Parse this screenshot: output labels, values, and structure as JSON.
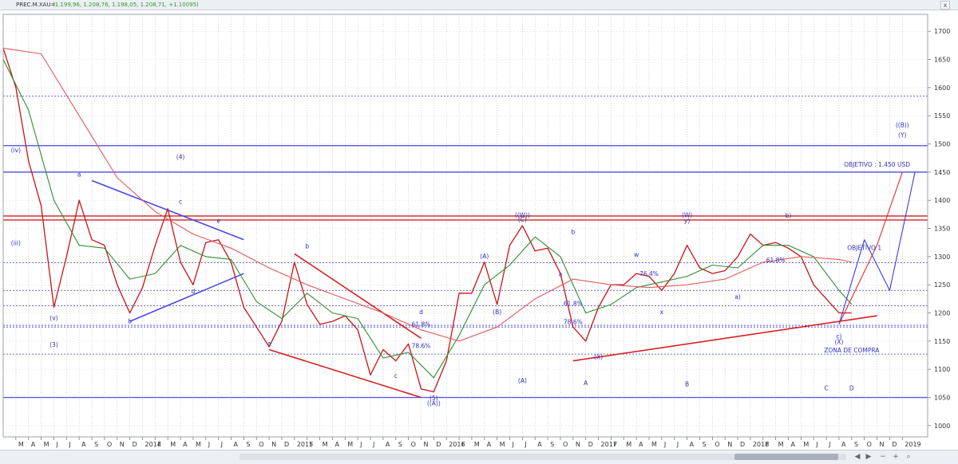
{
  "window": {
    "title": "PREC.M.XAU=",
    "quote_text": "(1.199,96, 1.208,76, 1.198,05, 1.208,71, +1.10095)",
    "close_glyph": "x"
  },
  "chart_data": {
    "type": "line",
    "title": "",
    "xlabel": "",
    "ylabel": "",
    "ylim": [
      980,
      1730
    ],
    "y_ticks": [
      1000,
      1050,
      1100,
      1150,
      1200,
      1250,
      1300,
      1350,
      1400,
      1450,
      1500,
      1550,
      1600,
      1650,
      1700
    ],
    "grid": true,
    "x_axis": {
      "start": "2013-02",
      "end": "2019-03",
      "labels": [
        "M",
        "A",
        "M",
        "J",
        "J",
        "A",
        "S",
        "O",
        "N",
        "D",
        "2014",
        "F",
        "M",
        "A",
        "M",
        "J",
        "J",
        "A",
        "S",
        "O",
        "N",
        "D",
        "2015",
        "F",
        "M",
        "A",
        "M",
        "J",
        "J",
        "A",
        "S",
        "O",
        "N",
        "D",
        "2016",
        "F",
        "M",
        "A",
        "M",
        "J",
        "J",
        "A",
        "S",
        "O",
        "N",
        "D",
        "2017",
        "F",
        "M",
        "A",
        "M",
        "J",
        "J",
        "A",
        "S",
        "O",
        "N",
        "D",
        "2018",
        "F",
        "M",
        "A",
        "M",
        "J",
        "J",
        "A",
        "S",
        "O",
        "N",
        "D",
        "2019"
      ]
    },
    "series": [
      {
        "role": "price",
        "color": "#c81414",
        "points": [
          [
            "2013-02",
            1670
          ],
          [
            "2013-03",
            1600
          ],
          [
            "2013-04",
            1470
          ],
          [
            "2013-05",
            1390
          ],
          [
            "2013-06",
            1210
          ],
          [
            "2013-07",
            1300
          ],
          [
            "2013-08",
            1400
          ],
          [
            "2013-09",
            1330
          ],
          [
            "2013-10",
            1320
          ],
          [
            "2013-11",
            1250
          ],
          [
            "2013-12",
            1200
          ],
          [
            "2014-01",
            1245
          ],
          [
            "2014-02",
            1320
          ],
          [
            "2014-03",
            1385
          ],
          [
            "2014-04",
            1290
          ],
          [
            "2014-05",
            1250
          ],
          [
            "2014-06",
            1325
          ],
          [
            "2014-07",
            1330
          ],
          [
            "2014-08",
            1290
          ],
          [
            "2014-09",
            1210
          ],
          [
            "2014-10",
            1175
          ],
          [
            "2014-11",
            1140
          ],
          [
            "2014-12",
            1185
          ],
          [
            "2015-01",
            1290
          ],
          [
            "2015-02",
            1215
          ],
          [
            "2015-03",
            1180
          ],
          [
            "2015-04",
            1185
          ],
          [
            "2015-05",
            1195
          ],
          [
            "2015-06",
            1170
          ],
          [
            "2015-07",
            1090
          ],
          [
            "2015-08",
            1135
          ],
          [
            "2015-09",
            1115
          ],
          [
            "2015-10",
            1145
          ],
          [
            "2015-11",
            1065
          ],
          [
            "2015-12",
            1060
          ],
          [
            "2016-01",
            1115
          ],
          [
            "2016-02",
            1235
          ],
          [
            "2016-03",
            1235
          ],
          [
            "2016-04",
            1290
          ],
          [
            "2016-05",
            1215
          ],
          [
            "2016-06",
            1320
          ],
          [
            "2016-07",
            1355
          ],
          [
            "2016-08",
            1310
          ],
          [
            "2016-09",
            1315
          ],
          [
            "2016-10",
            1270
          ],
          [
            "2016-11",
            1175
          ],
          [
            "2016-12",
            1150
          ],
          [
            "2017-01",
            1210
          ],
          [
            "2017-02",
            1250
          ],
          [
            "2017-03",
            1250
          ],
          [
            "2017-04",
            1270
          ],
          [
            "2017-05",
            1265
          ],
          [
            "2017-06",
            1240
          ],
          [
            "2017-07",
            1270
          ],
          [
            "2017-08",
            1320
          ],
          [
            "2017-09",
            1280
          ],
          [
            "2017-10",
            1270
          ],
          [
            "2017-11",
            1275
          ],
          [
            "2017-12",
            1300
          ],
          [
            "2018-01",
            1340
          ],
          [
            "2018-02",
            1320
          ],
          [
            "2018-03",
            1325
          ],
          [
            "2018-04",
            1315
          ],
          [
            "2018-05",
            1300
          ],
          [
            "2018-06",
            1250
          ],
          [
            "2018-07",
            1225
          ],
          [
            "2018-08",
            1200
          ],
          [
            "2018-09",
            1200
          ]
        ]
      },
      {
        "role": "short-ma",
        "color": "#2f8f2f",
        "points": [
          [
            "2013-02",
            1650
          ],
          [
            "2013-04",
            1560
          ],
          [
            "2013-06",
            1400
          ],
          [
            "2013-08",
            1320
          ],
          [
            "2013-10",
            1315
          ],
          [
            "2013-12",
            1260
          ],
          [
            "2014-02",
            1270
          ],
          [
            "2014-04",
            1320
          ],
          [
            "2014-06",
            1300
          ],
          [
            "2014-08",
            1295
          ],
          [
            "2014-10",
            1220
          ],
          [
            "2014-12",
            1190
          ],
          [
            "2015-02",
            1235
          ],
          [
            "2015-04",
            1200
          ],
          [
            "2015-06",
            1190
          ],
          [
            "2015-08",
            1120
          ],
          [
            "2015-10",
            1130
          ],
          [
            "2015-12",
            1085
          ],
          [
            "2016-02",
            1160
          ],
          [
            "2016-04",
            1250
          ],
          [
            "2016-06",
            1285
          ],
          [
            "2016-08",
            1335
          ],
          [
            "2016-10",
            1300
          ],
          [
            "2016-12",
            1200
          ],
          [
            "2017-02",
            1215
          ],
          [
            "2017-04",
            1245
          ],
          [
            "2017-06",
            1255
          ],
          [
            "2017-08",
            1265
          ],
          [
            "2017-10",
            1285
          ],
          [
            "2017-12",
            1280
          ],
          [
            "2018-02",
            1320
          ],
          [
            "2018-04",
            1320
          ],
          [
            "2018-06",
            1300
          ],
          [
            "2018-08",
            1240
          ],
          [
            "2018-09",
            1215
          ]
        ]
      },
      {
        "role": "long-ma",
        "color": "#e05a5a",
        "points": [
          [
            "2013-02",
            1670
          ],
          [
            "2013-05",
            1660
          ],
          [
            "2013-08",
            1550
          ],
          [
            "2013-11",
            1440
          ],
          [
            "2014-02",
            1380
          ],
          [
            "2014-05",
            1340
          ],
          [
            "2014-08",
            1315
          ],
          [
            "2014-11",
            1280
          ],
          [
            "2015-02",
            1250
          ],
          [
            "2015-05",
            1225
          ],
          [
            "2015-08",
            1200
          ],
          [
            "2015-11",
            1170
          ],
          [
            "2016-02",
            1150
          ],
          [
            "2016-05",
            1175
          ],
          [
            "2016-08",
            1225
          ],
          [
            "2016-11",
            1260
          ],
          [
            "2017-02",
            1250
          ],
          [
            "2017-05",
            1245
          ],
          [
            "2017-08",
            1250
          ],
          [
            "2017-11",
            1260
          ],
          [
            "2018-02",
            1290
          ],
          [
            "2018-05",
            1300
          ],
          [
            "2018-08",
            1295
          ],
          [
            "2018-09",
            1290
          ]
        ]
      },
      {
        "role": "projection-red",
        "color": "#e03030",
        "points": [
          [
            "2018-08",
            1180
          ],
          [
            "2018-11",
            1320
          ],
          [
            "2019-01",
            1450
          ]
        ]
      },
      {
        "role": "projection-blue",
        "color": "#3c3ce0",
        "points": [
          [
            "2018-08",
            1180
          ],
          [
            "2018-10",
            1330
          ],
          [
            "2018-12",
            1240
          ],
          [
            "2019-02",
            1450
          ]
        ]
      }
    ],
    "horizontal_levels": [
      {
        "price": 1585,
        "style": "dotted",
        "color": "#3c3ce0"
      },
      {
        "price": 1497,
        "style": "solid",
        "color": "#5a5ae0"
      },
      {
        "price": 1450,
        "style": "solid",
        "color": "#5a5ae0"
      },
      {
        "price": 1372,
        "style": "solid",
        "color": "#d02020"
      },
      {
        "price": 1365,
        "style": "solid",
        "color": "#d02020"
      },
      {
        "price": 1289,
        "style": "dotted",
        "color": "#3c3ce0"
      },
      {
        "price": 1240,
        "style": "dotted",
        "color": "#3c3ce0"
      },
      {
        "price": 1213,
        "style": "dotted",
        "color": "#3c3ce0"
      },
      {
        "price": 1178,
        "style": "dotted",
        "color": "#3c3ce0"
      },
      {
        "price": 1175,
        "style": "dotted",
        "color": "#3c3ce0"
      },
      {
        "price": 1127,
        "style": "dotted",
        "color": "#3c3ce0"
      },
      {
        "price": 1050,
        "style": "solid",
        "color": "#5a5ae0"
      }
    ],
    "trend_lines": [
      {
        "from": [
          "2013-09",
          1435
        ],
        "to": [
          "2014-09",
          1330
        ],
        "color": "#4a4ae0"
      },
      {
        "from": [
          "2013-12",
          1185
        ],
        "to": [
          "2014-09",
          1270
        ],
        "color": "#4a4ae0"
      },
      {
        "from": [
          "2015-01",
          1305
        ],
        "to": [
          "2015-11",
          1155
        ],
        "color": "#d82020"
      },
      {
        "from": [
          "2014-11",
          1135
        ],
        "to": [
          "2015-11",
          1050
        ],
        "color": "#d82020"
      },
      {
        "from": [
          "2016-11",
          1115
        ],
        "to": [
          "2018-11",
          1195
        ],
        "color": "#d82020"
      }
    ],
    "annotations": [
      {
        "text": "(iv)",
        "x": "2013-03",
        "y": 1485,
        "color": "#3030c0"
      },
      {
        "text": "(iii)",
        "x": "2013-03",
        "y": 1320,
        "color": "#3030c0"
      },
      {
        "text": "(v)",
        "x": "2013-06",
        "y": 1187,
        "color": "#3030c0"
      },
      {
        "text": "(3)",
        "x": "2013-06",
        "y": 1140,
        "color": "#3030c0"
      },
      {
        "text": "a",
        "x": "2013-08",
        "y": 1442,
        "color": "#3030c0"
      },
      {
        "text": "(4)",
        "x": "2014-04",
        "y": 1473,
        "color": "#3030c0"
      },
      {
        "text": "c",
        "x": "2014-04",
        "y": 1394,
        "color": "#3030c0"
      },
      {
        "text": "e",
        "x": "2014-07",
        "y": 1360,
        "color": "#3030c0"
      },
      {
        "text": "d",
        "x": "2014-05",
        "y": 1235,
        "color": "#3030c0"
      },
      {
        "text": "b",
        "x": "2013-12",
        "y": 1182,
        "color": "#3030c0"
      },
      {
        "text": "b",
        "x": "2015-02",
        "y": 1315,
        "color": "#3030c0"
      },
      {
        "text": "a",
        "x": "2014-11",
        "y": 1142,
        "color": "#3030c0"
      },
      {
        "text": "d",
        "x": "2015-11",
        "y": 1198,
        "color": "#3030c0"
      },
      {
        "text": "c",
        "x": "2015-09",
        "y": 1085,
        "color": "#3030c0"
      },
      {
        "text": "(5)",
        "x": "2015-12",
        "y": 1045,
        "color": "#3030c0"
      },
      {
        "text": "((A))",
        "x": "2015-12",
        "y": 1036,
        "color": "#3030c0"
      },
      {
        "text": "61.8%",
        "x": "2015-11",
        "y": 1176,
        "color": "#3030c0"
      },
      {
        "text": "78.6%",
        "x": "2015-11",
        "y": 1138,
        "color": "#3030c0"
      },
      {
        "text": "(A)",
        "x": "2016-04",
        "y": 1297,
        "color": "#3030c0"
      },
      {
        "text": "(B)",
        "x": "2016-05",
        "y": 1198,
        "color": "#3030c0"
      },
      {
        "text": "((W))",
        "x": "2016-07",
        "y": 1370,
        "color": "#3030c0"
      },
      {
        "text": "(C)",
        "x": "2016-07",
        "y": 1362,
        "color": "#3030c0"
      },
      {
        "text": "b",
        "x": "2016-11",
        "y": 1340,
        "color": "#3030c0"
      },
      {
        "text": "a",
        "x": "2016-10",
        "y": 1265,
        "color": "#3030c0"
      },
      {
        "text": "61.8%",
        "x": "2016-11",
        "y": 1213,
        "color": "#3030c0"
      },
      {
        "text": "78.6%",
        "x": "2016-11",
        "y": 1180,
        "color": "#3030c0"
      },
      {
        "text": "(X)",
        "x": "2017-01",
        "y": 1118,
        "color": "#3030c0"
      },
      {
        "text": "(A)",
        "x": "2016-07",
        "y": 1076,
        "color": "#3030c0"
      },
      {
        "text": "A",
        "x": "2016-12",
        "y": 1072,
        "color": "#3030c0"
      },
      {
        "text": "w",
        "x": "2017-04",
        "y": 1300,
        "color": "#3030c0"
      },
      {
        "text": "76.4%",
        "x": "2017-05",
        "y": 1266,
        "color": "#3030c0"
      },
      {
        "text": "x",
        "x": "2017-06",
        "y": 1198,
        "color": "#3030c0"
      },
      {
        "text": "(W)",
        "x": "2017-08",
        "y": 1370,
        "color": "#3030c0"
      },
      {
        "text": "y)",
        "x": "2017-08",
        "y": 1360,
        "color": "#3030c0"
      },
      {
        "text": "B",
        "x": "2017-08",
        "y": 1070,
        "color": "#3030c0"
      },
      {
        "text": "a)",
        "x": "2017-12",
        "y": 1225,
        "color": "#3030c0"
      },
      {
        "text": "b)",
        "x": "2018-04",
        "y": 1369,
        "color": "#3030c0"
      },
      {
        "text": "61.8%",
        "x": "2018-03",
        "y": 1290,
        "color": "#3030c0"
      },
      {
        "text": "c)",
        "x": "2018-08",
        "y": 1155,
        "color": "#3030c0"
      },
      {
        "text": "(X)",
        "x": "2018-08",
        "y": 1145,
        "color": "#3030c0"
      },
      {
        "text": "ZONA DE COMPRA",
        "x": "2018-09",
        "y": 1130,
        "color": "#3030c0"
      },
      {
        "text": "C",
        "x": "2018-07",
        "y": 1063,
        "color": "#3030c0"
      },
      {
        "text": "D",
        "x": "2018-09",
        "y": 1063,
        "color": "#3030c0"
      },
      {
        "text": "OBJETIVO 1",
        "x": "2018-10",
        "y": 1312,
        "color": "#3030c0"
      },
      {
        "text": "OBJETIVO : 1.450 USD",
        "x": "2018-11",
        "y": 1460,
        "color": "#3030c0"
      },
      {
        "text": "((B))",
        "x": "2019-01",
        "y": 1530,
        "color": "#3030c0"
      },
      {
        "text": "(Y)",
        "x": "2019-01",
        "y": 1512,
        "color": "#3030c0"
      }
    ]
  },
  "statusbar": {
    "icons": [
      "arrow-left-icon",
      "arrow-right-icon",
      "zoom-out-icon",
      "zoom-in-icon",
      "search-icon"
    ],
    "glyphs": [
      "◀",
      "▶",
      "−",
      "+",
      "⌕"
    ]
  }
}
